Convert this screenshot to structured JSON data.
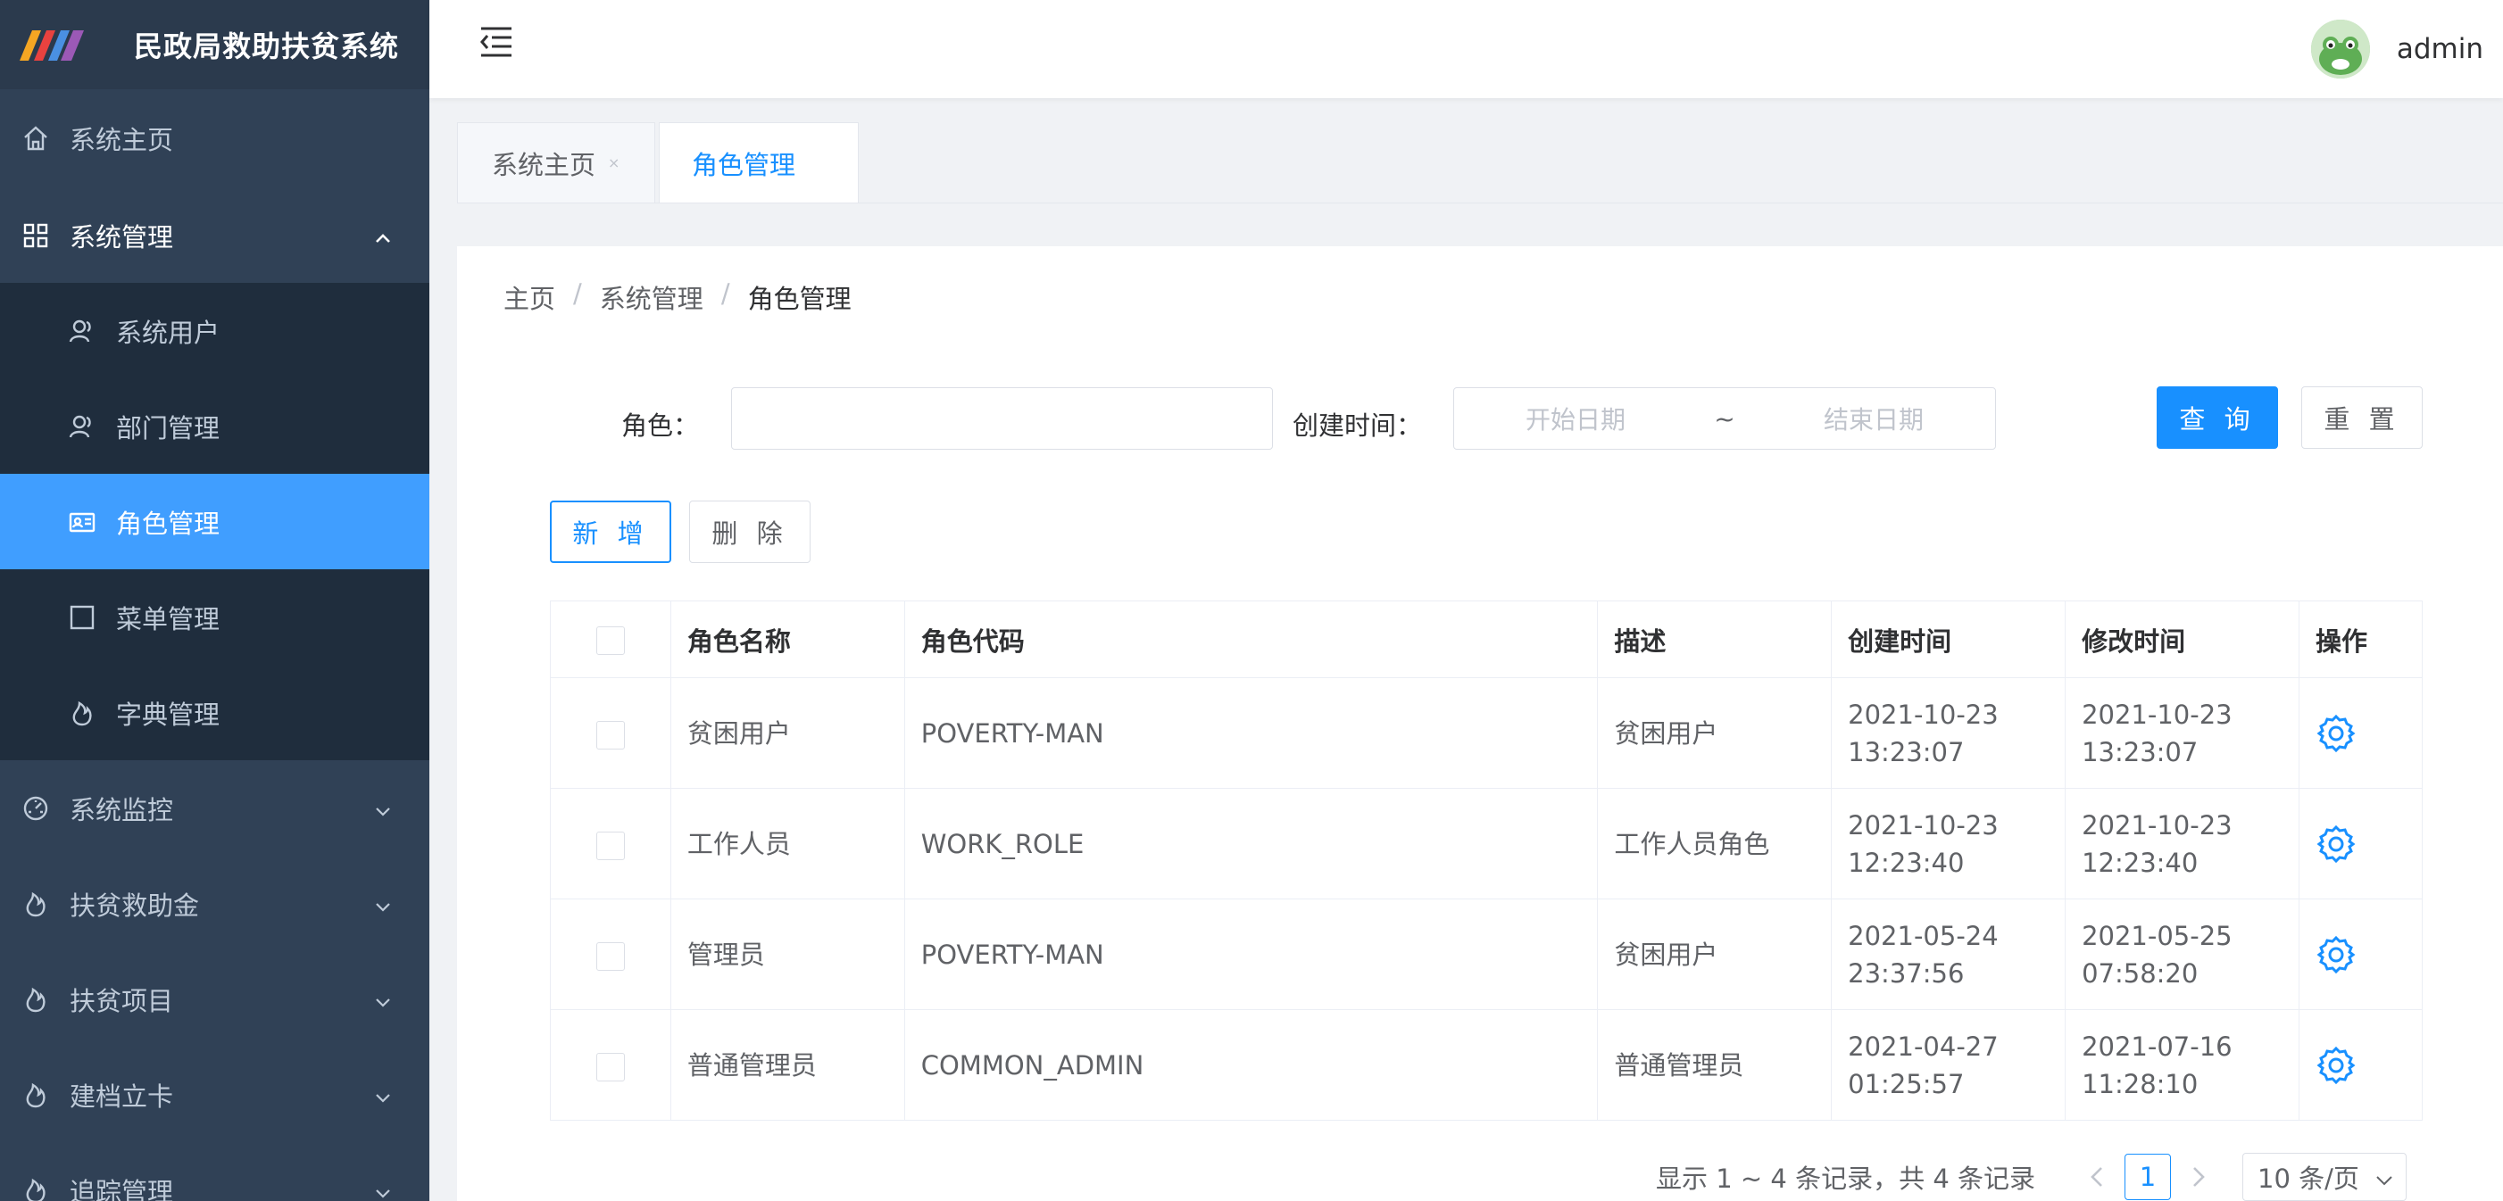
{
  "app": {
    "title": "民政局救助扶贫系统",
    "username": "admin"
  },
  "sidebar": {
    "items": [
      {
        "label": "系统主页",
        "icon": "home-icon"
      },
      {
        "label": "系统管理",
        "icon": "grid-icon",
        "expanded": true,
        "children": [
          {
            "label": "系统用户",
            "icon": "user-icon"
          },
          {
            "label": "部门管理",
            "icon": "user-icon"
          },
          {
            "label": "角色管理",
            "icon": "id-card-icon",
            "active": true
          },
          {
            "label": "菜单管理",
            "icon": "square-icon"
          },
          {
            "label": "字典管理",
            "icon": "fire-icon"
          }
        ]
      },
      {
        "label": "系统监控",
        "icon": "dashboard-icon"
      },
      {
        "label": "扶贫救助金",
        "icon": "fire-icon"
      },
      {
        "label": "扶贫项目",
        "icon": "fire-icon"
      },
      {
        "label": "建档立卡",
        "icon": "fire-icon"
      },
      {
        "label": "追踪管理",
        "icon": "fire-icon"
      }
    ]
  },
  "tabs": [
    {
      "label": "系统主页",
      "active": false
    },
    {
      "label": "角色管理",
      "active": true
    }
  ],
  "breadcrumb": [
    "主页",
    "系统管理",
    "角色管理"
  ],
  "breadcrumb_sep": "/",
  "filter": {
    "role_label": "角色：",
    "role_value": "",
    "created_label": "创建时间：",
    "start_placeholder": "开始日期",
    "range_sep": "~",
    "end_placeholder": "结束日期",
    "query_button": "查 询",
    "reset_button": "重 置"
  },
  "toolbar": {
    "add_button": "新 增",
    "delete_button": "删 除"
  },
  "table": {
    "columns": [
      "角色名称",
      "角色代码",
      "描述",
      "创建时间",
      "修改时间",
      "操作"
    ],
    "rows": [
      {
        "name": "贫困用户",
        "code": "POVERTY-MAN",
        "desc": "贫困用户",
        "created_date": "2021-10-23",
        "created_time": "13:23:07",
        "modified_date": "2021-10-23",
        "modified_time": "13:23:07"
      },
      {
        "name": "工作人员",
        "code": "WORK_ROLE",
        "desc": "工作人员角色",
        "created_date": "2021-10-23",
        "created_time": "12:23:40",
        "modified_date": "2021-10-23",
        "modified_time": "12:23:40"
      },
      {
        "name": "管理员",
        "code": "POVERTY-MAN",
        "desc": "贫困用户",
        "created_date": "2021-05-24",
        "created_time": "23:37:56",
        "modified_date": "2021-05-25",
        "modified_time": "07:58:20"
      },
      {
        "name": "普通管理员",
        "code": "COMMON_ADMIN",
        "desc": "普通管理员",
        "created_date": "2021-04-27",
        "created_time": "01:25:57",
        "modified_date": "2021-07-16",
        "modified_time": "11:28:10"
      }
    ]
  },
  "pagination": {
    "summary": "显示 1 ~ 4 条记录，共 4 条记录",
    "current_page": "1",
    "page_size": "10 条/页"
  },
  "colors": {
    "sidebar_bg": "#304156",
    "active": "#409eff",
    "primary": "#1890ff"
  }
}
